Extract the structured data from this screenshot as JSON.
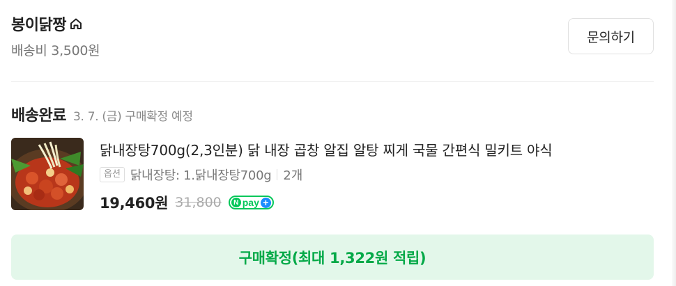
{
  "store": {
    "name": "봉이닭짱",
    "shipping_fee": "배송비 3,500원",
    "inquiry_label": "문의하기"
  },
  "order": {
    "status": "배송완료",
    "status_detail": "3. 7. (금) 구매확정 예정"
  },
  "product": {
    "name": "닭내장탕700g(2,3인분) 닭 내장 곱창 알집 알탕 찌게 국물 간편식 밀키트 야식",
    "option_tag": "옵션",
    "option_text": "닭내장탕: 1.닭내장탕700g",
    "quantity": "2개",
    "price": "19,460원",
    "original_price": "31,800",
    "npay_label": "pay"
  },
  "confirm": {
    "label": "구매확정(최대 1,322원 적립)"
  },
  "colors": {
    "accent_green": "#04a948",
    "confirm_bg": "#e3f7ea",
    "npay_blue": "#1a8cff"
  }
}
